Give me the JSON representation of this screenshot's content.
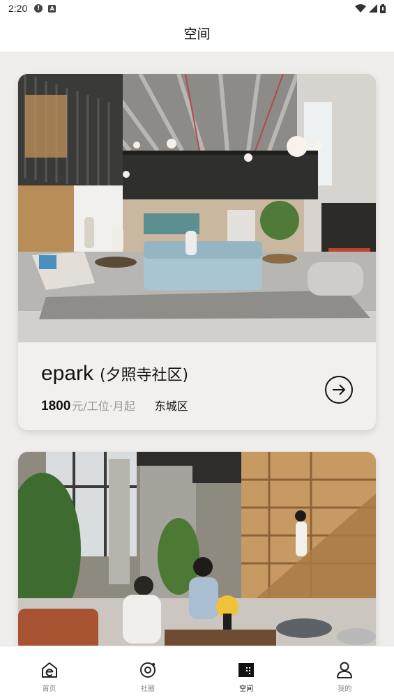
{
  "status_bar": {
    "time": "2:20",
    "notification_badge": "!",
    "app_badge": "A"
  },
  "header": {
    "title": "空间"
  },
  "spaces": [
    {
      "name": "epark",
      "community": "(夕照寺社区)",
      "price": "1800",
      "price_unit": "元/工位·月起",
      "district": "东城区"
    }
  ],
  "nav": {
    "items": [
      {
        "label": "首页",
        "icon": "home-e-icon",
        "active": false
      },
      {
        "label": "社圈",
        "icon": "circle-community-icon",
        "active": false
      },
      {
        "label": "空间",
        "icon": "space-icon",
        "active": true
      },
      {
        "label": "我的",
        "icon": "user-icon",
        "active": false
      }
    ]
  },
  "colors": {
    "background": "#efeeec",
    "card": "#f1f0ee",
    "price_unit": "#9a9a9a",
    "nav_inactive": "#888888",
    "nav_active": "#111111"
  }
}
